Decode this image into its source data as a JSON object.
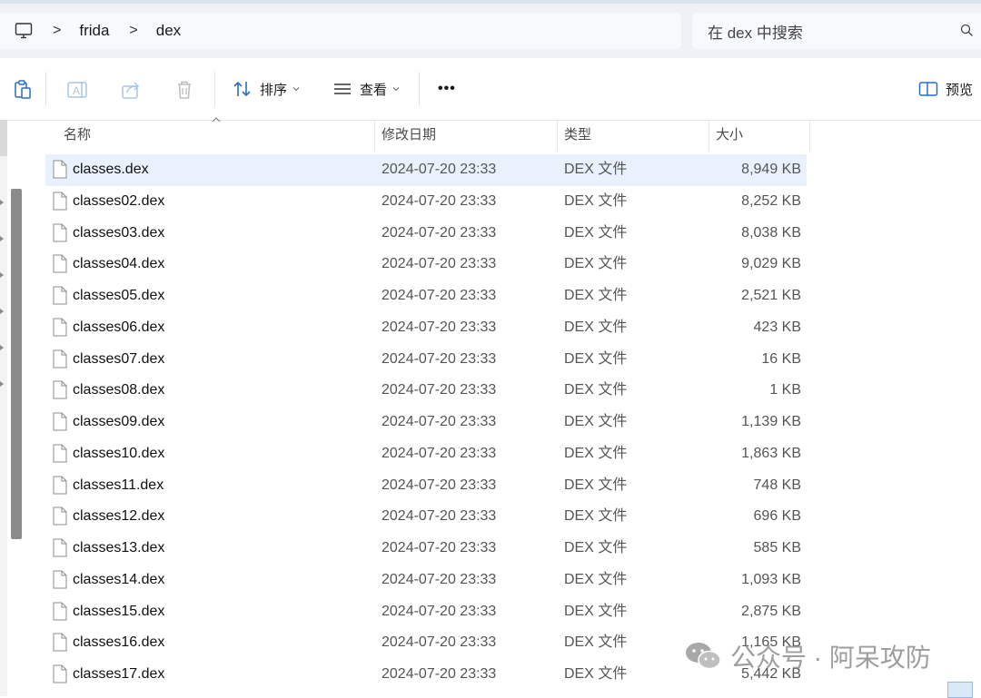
{
  "address": {
    "crumbs": [
      "frida",
      "dex"
    ],
    "separator": ">",
    "search_placeholder": "在 dex 中搜索"
  },
  "toolbar": {
    "sort_label": "排序",
    "view_label": "查看",
    "more_label": "•••",
    "preview_label": "预览"
  },
  "columns": {
    "name": "名称",
    "modified": "修改日期",
    "type": "类型",
    "size": "大小"
  },
  "files": [
    {
      "name": "classes.dex",
      "modified": "2024-07-20 23:33",
      "type": "DEX 文件",
      "size": "8,949 KB",
      "selected": true
    },
    {
      "name": "classes02.dex",
      "modified": "2024-07-20 23:33",
      "type": "DEX 文件",
      "size": "8,252 KB"
    },
    {
      "name": "classes03.dex",
      "modified": "2024-07-20 23:33",
      "type": "DEX 文件",
      "size": "8,038 KB"
    },
    {
      "name": "classes04.dex",
      "modified": "2024-07-20 23:33",
      "type": "DEX 文件",
      "size": "9,029 KB"
    },
    {
      "name": "classes05.dex",
      "modified": "2024-07-20 23:33",
      "type": "DEX 文件",
      "size": "2,521 KB"
    },
    {
      "name": "classes06.dex",
      "modified": "2024-07-20 23:33",
      "type": "DEX 文件",
      "size": "423 KB"
    },
    {
      "name": "classes07.dex",
      "modified": "2024-07-20 23:33",
      "type": "DEX 文件",
      "size": "16 KB"
    },
    {
      "name": "classes08.dex",
      "modified": "2024-07-20 23:33",
      "type": "DEX 文件",
      "size": "1 KB"
    },
    {
      "name": "classes09.dex",
      "modified": "2024-07-20 23:33",
      "type": "DEX 文件",
      "size": "1,139 KB"
    },
    {
      "name": "classes10.dex",
      "modified": "2024-07-20 23:33",
      "type": "DEX 文件",
      "size": "1,863 KB"
    },
    {
      "name": "classes11.dex",
      "modified": "2024-07-20 23:33",
      "type": "DEX 文件",
      "size": "748 KB"
    },
    {
      "name": "classes12.dex",
      "modified": "2024-07-20 23:33",
      "type": "DEX 文件",
      "size": "696 KB"
    },
    {
      "name": "classes13.dex",
      "modified": "2024-07-20 23:33",
      "type": "DEX 文件",
      "size": "585 KB"
    },
    {
      "name": "classes14.dex",
      "modified": "2024-07-20 23:33",
      "type": "DEX 文件",
      "size": "1,093 KB"
    },
    {
      "name": "classes15.dex",
      "modified": "2024-07-20 23:33",
      "type": "DEX 文件",
      "size": "2,875 KB"
    },
    {
      "name": "classes16.dex",
      "modified": "2024-07-20 23:33",
      "type": "DEX 文件",
      "size": "1,165 KB"
    },
    {
      "name": "classes17.dex",
      "modified": "2024-07-20 23:33",
      "type": "DEX 文件",
      "size": "5,442 KB"
    }
  ],
  "watermark": {
    "text": "公众号 · 阿呆攻防",
    "icon": "wechat-icon"
  },
  "colors": {
    "selection": "#e9f2fc",
    "accent": "#0067c0",
    "chrome": "#eef1f6"
  }
}
